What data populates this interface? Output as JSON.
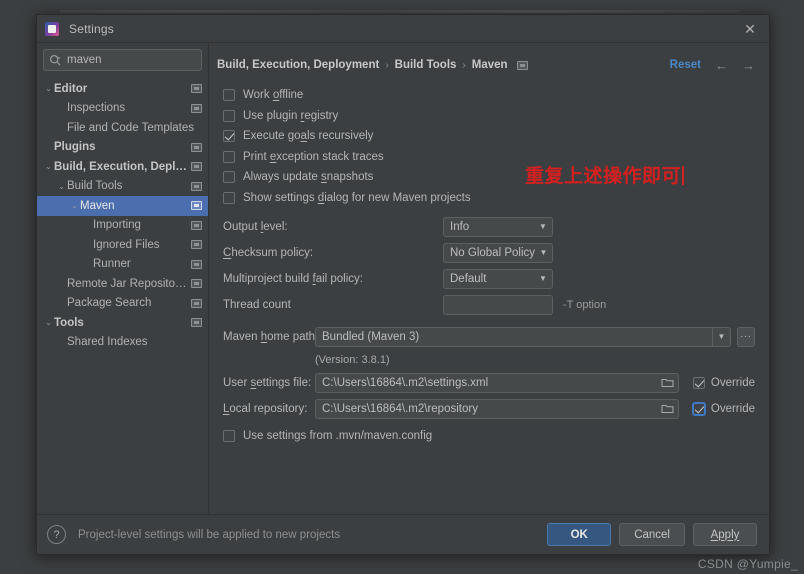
{
  "window": {
    "title": "Settings",
    "app_icon": "intellij-idea-icon",
    "close_icon": "close-icon"
  },
  "sidebar": {
    "search": {
      "value": "maven",
      "placeholder": "",
      "icon": "search-icon",
      "clear_icon": "clear-icon"
    },
    "items": [
      {
        "label": "Editor",
        "indent": 0,
        "arrow": "⌄",
        "bold": true,
        "project_icon": true,
        "selected": false
      },
      {
        "label": "Inspections",
        "indent": 1,
        "arrow": "",
        "bold": false,
        "project_icon": true,
        "selected": false
      },
      {
        "label": "File and Code Templates",
        "indent": 1,
        "arrow": "",
        "bold": false,
        "project_icon": false,
        "selected": false
      },
      {
        "label": "Plugins",
        "indent": 0,
        "arrow": "",
        "bold": true,
        "project_icon": true,
        "selected": false
      },
      {
        "label": "Build, Execution, Deployment",
        "indent": 0,
        "arrow": "⌄",
        "bold": true,
        "project_icon": true,
        "selected": false
      },
      {
        "label": "Build Tools",
        "indent": 1,
        "arrow": "⌄",
        "bold": false,
        "project_icon": true,
        "selected": false
      },
      {
        "label": "Maven",
        "indent": 2,
        "arrow": "⌄",
        "bold": false,
        "project_icon": true,
        "selected": true
      },
      {
        "label": "Importing",
        "indent": 3,
        "arrow": "",
        "bold": false,
        "project_icon": true,
        "selected": false
      },
      {
        "label": "Ignored Files",
        "indent": 3,
        "arrow": "",
        "bold": false,
        "project_icon": true,
        "selected": false
      },
      {
        "label": "Runner",
        "indent": 3,
        "arrow": "",
        "bold": false,
        "project_icon": true,
        "selected": false
      },
      {
        "label": "Remote Jar Repositories",
        "indent": 1,
        "arrow": "",
        "bold": false,
        "project_icon": true,
        "selected": false
      },
      {
        "label": "Package Search",
        "indent": 1,
        "arrow": "",
        "bold": false,
        "project_icon": true,
        "selected": false
      },
      {
        "label": "Tools",
        "indent": 0,
        "arrow": "⌄",
        "bold": true,
        "project_icon": true,
        "selected": false
      },
      {
        "label": "Shared Indexes",
        "indent": 1,
        "arrow": "",
        "bold": false,
        "project_icon": false,
        "selected": false
      }
    ]
  },
  "breadcrumb": {
    "crumbs": [
      "Build, Execution, Deployment",
      "Build Tools",
      "Maven"
    ],
    "separator": "›",
    "project_icon": "project-settings-icon",
    "reset_label": "Reset",
    "back_icon": "←",
    "forward_icon": "→"
  },
  "checkboxes": [
    {
      "label_pre": "Work ",
      "mnemonic": "o",
      "label_post": "ffline",
      "checked": false
    },
    {
      "label_pre": "Use plugin ",
      "mnemonic": "r",
      "label_post": "egistry",
      "checked": false
    },
    {
      "label_pre": "Execute go",
      "mnemonic": "a",
      "label_post": "ls recursively",
      "checked": true
    },
    {
      "label_pre": "Print ",
      "mnemonic": "e",
      "label_post": "xception stack traces",
      "checked": false
    },
    {
      "label_pre": "Always update ",
      "mnemonic": "s",
      "label_post": "napshots",
      "checked": false
    },
    {
      "label_pre": "Show settings ",
      "mnemonic": "d",
      "label_post": "ialog for new Maven projects",
      "checked": false
    }
  ],
  "fields": {
    "output_level": {
      "label_pre": "Output ",
      "mnemonic": "l",
      "label_post": "evel:",
      "value": "Info"
    },
    "checksum_policy": {
      "label_pre": "",
      "mnemonic": "C",
      "label_post": "hecksum policy:",
      "value": "No Global Policy"
    },
    "multiproject_fail": {
      "label_pre": "Multiproject build ",
      "mnemonic": "f",
      "label_post": "ail policy:",
      "value": "Default"
    },
    "thread_count": {
      "label": "Thread count",
      "value": "",
      "hint": "-T option"
    },
    "maven_home": {
      "label_pre": "Maven ",
      "mnemonic": "h",
      "label_post": "ome path:",
      "value": "Bundled (Maven 3)",
      "version_note": "(Version: 3.8.1)",
      "browse_label": "..."
    },
    "user_settings": {
      "label_pre": "User ",
      "mnemonic": "s",
      "label_post": "ettings file:",
      "value": "C:\\Users\\16864\\.m2\\settings.xml",
      "override_label": "Override",
      "override_checked": true,
      "override_focused": false
    },
    "local_repository": {
      "label_pre": "",
      "mnemonic": "L",
      "label_post": "ocal repository:",
      "value": "C:\\Users\\16864\\.m2\\repository",
      "override_label": "Override",
      "override_checked": true,
      "override_focused": true
    },
    "use_mvn_config": {
      "label_pre": "Use settings from .mvn/maven.config",
      "mnemonic": "",
      "label_post": "",
      "checked": false
    }
  },
  "annotation": {
    "text": "重复上述操作即可",
    "color": "#d32020"
  },
  "footer": {
    "help_icon": "?",
    "note": "Project-level settings will be applied to new projects",
    "ok_label": "OK",
    "cancel_label": "Cancel",
    "apply_label": "Apply"
  },
  "watermark": {
    "text": "CSDN @Yumpie_"
  },
  "colors": {
    "dialog_bg": "#3c3f41",
    "selection_blue": "#4b6eaf",
    "accent_link": "#4a88c7",
    "primary_button": "#365880",
    "annotation_red": "#d32020"
  }
}
